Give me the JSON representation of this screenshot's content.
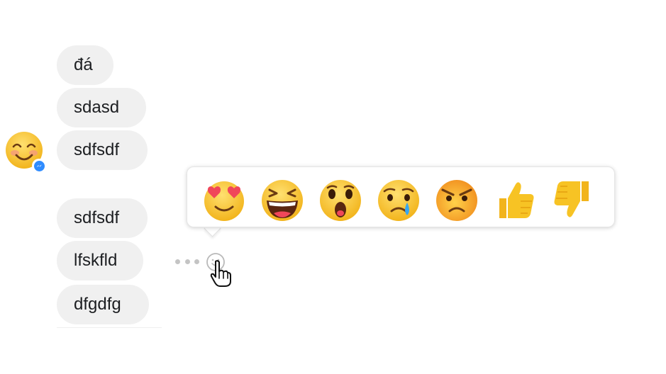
{
  "messages": [
    {
      "text": "đá"
    },
    {
      "text": "sdasd"
    },
    {
      "text": "sdfsdf"
    },
    {
      "text": "sdfsdf"
    },
    {
      "text": "lfskfld"
    },
    {
      "text": "dfgdfg"
    }
  ],
  "reactions": [
    {
      "name": "love",
      "icon": "heart-eyes-emoji"
    },
    {
      "name": "haha",
      "icon": "laughing-emoji"
    },
    {
      "name": "wow",
      "icon": "surprised-emoji"
    },
    {
      "name": "sad",
      "icon": "crying-emoji"
    },
    {
      "name": "angry",
      "icon": "angry-emoji"
    },
    {
      "name": "like",
      "icon": "thumbs-up-emoji"
    },
    {
      "name": "dislike",
      "icon": "thumbs-down-emoji"
    }
  ],
  "colors": {
    "bubble": "#f0f0f0",
    "emoji_yellow": "#f7c324",
    "messenger_blue": "#2f8cff"
  }
}
